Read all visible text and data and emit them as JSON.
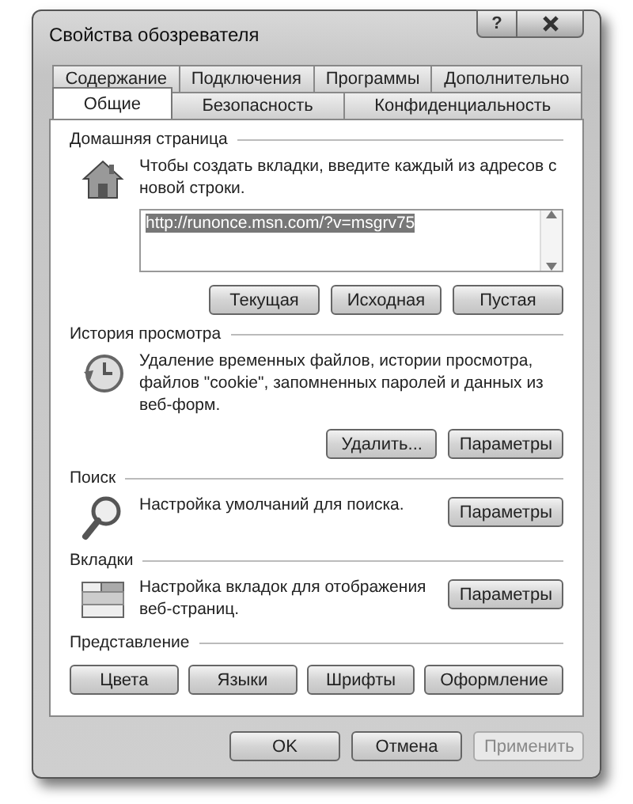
{
  "window": {
    "title": "Свойства обозревателя",
    "help_label": "?"
  },
  "tab_rows": [
    {
      "tabs": [
        {
          "label": "Содержание",
          "selected": false
        },
        {
          "label": "Подключения",
          "selected": false
        },
        {
          "label": "Программы",
          "selected": false
        },
        {
          "label": "Дополнительно",
          "selected": false
        }
      ]
    },
    {
      "tabs": [
        {
          "label": "Общие",
          "selected": true
        },
        {
          "label": "Безопасность",
          "selected": false
        },
        {
          "label": "Конфиденциальность",
          "selected": false
        }
      ]
    }
  ],
  "sections": [
    {
      "heading": "Домашняя страница",
      "kind": "home",
      "description": "Чтобы создать вкладки, введите каждый из адресов с новой строки.",
      "field": {
        "value": "http://runonce.msn.com/?v=msgrv75",
        "selected": true
      },
      "buttons": [
        "Текущая",
        "Исходная",
        "Пустая"
      ]
    },
    {
      "heading": "История просмотра",
      "kind": "history",
      "description": "Удаление временных файлов, истории просмотра, файлов \"cookie\", запомненных паролей и данных из веб-форм.",
      "buttons": [
        "Удалить...",
        "Параметры"
      ]
    },
    {
      "heading": "Поиск",
      "kind": "search",
      "description": "Настройка умолчаний для поиска.",
      "buttons": [
        "Параметры"
      ]
    },
    {
      "heading": "Вкладки",
      "kind": "tabs",
      "description": "Настройка вкладок для отображения веб-страниц.",
      "buttons": [
        "Параметры"
      ]
    },
    {
      "heading": "Представление",
      "kind": "plain",
      "buttons": [
        "Цвета",
        "Языки",
        "Шрифты",
        "Оформление"
      ]
    }
  ],
  "footer_buttons": [
    {
      "label": "OK",
      "disabled": false
    },
    {
      "label": "Отмена",
      "disabled": false
    },
    {
      "label": "Применить",
      "disabled": true
    }
  ]
}
